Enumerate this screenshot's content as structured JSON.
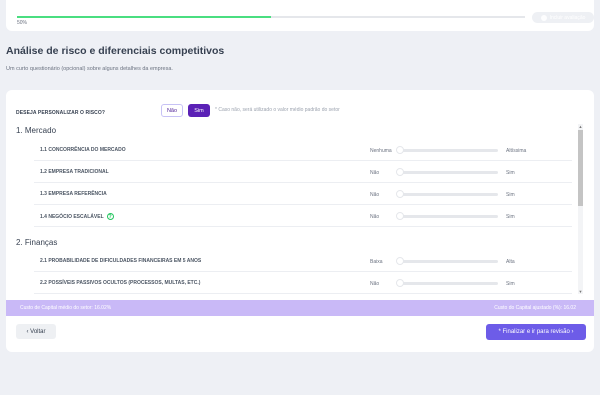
{
  "progress": {
    "percent": 50,
    "label": "50%"
  },
  "top_button": {
    "label": "Incluir avaliação"
  },
  "page": {
    "title": "Análise de risco e diferenciais competitivos",
    "subtitle": "Um curto questionário (opcional) sobre alguns detalhes da empresa."
  },
  "question": {
    "label": "DESEJA PERSONALIZAR O RISCO?",
    "no_label": "Não",
    "yes_label": "Sim",
    "note": "* Caso não, será utilizado o valor médio padrão do setor"
  },
  "sections": [
    {
      "title": "1. Mercado",
      "items": [
        {
          "label": "1.1 CONCORRÊNCIA DO MERCADO",
          "min": "Nenhuma",
          "max": "Altíssima",
          "value": 0,
          "help": false
        },
        {
          "label": "1.2 EMPRESA TRADICIONAL",
          "min": "Não",
          "max": "Sim",
          "value": 0,
          "help": false
        },
        {
          "label": "1.3 EMPRESA REFERÊNCIA",
          "min": "Não",
          "max": "Sim",
          "value": 0,
          "help": false
        },
        {
          "label": "1.4 NEGÓCIO ESCALÁVEL",
          "min": "Não",
          "max": "Sim",
          "value": 0,
          "help": true
        }
      ]
    },
    {
      "title": "2. Finanças",
      "items": [
        {
          "label": "2.1 PROBABILIDADE DE DIFICULDADES FINANCEIRAS EM 5 ANOS",
          "min": "Baixa",
          "max": "Alta",
          "value": 0,
          "help": false
        },
        {
          "label": "2.2 POSSÍVEIS PASSIVOS OCULTOS (PROCESSOS, MULTAS, ETC.)",
          "min": "Não",
          "max": "Sim",
          "value": 0,
          "help": false
        }
      ]
    }
  ],
  "footer": {
    "left": "Custo de Capital médio do setor: 16.02%",
    "right": "Custo do Capital ajustado (%): 16.02"
  },
  "buttons": {
    "back": "‹ Voltar",
    "finish": "* Finalizar e ir para revisão ›"
  },
  "icons": {
    "help": "?",
    "scroll_up": "▲",
    "scroll_down": "▼"
  },
  "colors": {
    "accent": "#5b21b6",
    "primary_button": "#6d5ce8",
    "footer_band": "#c9b9f7",
    "progress": "#4ade80",
    "help_icon": "#22c55e"
  }
}
